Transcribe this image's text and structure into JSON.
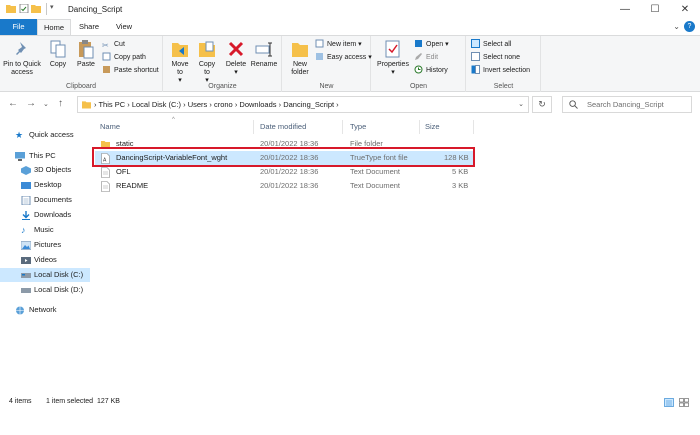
{
  "window": {
    "title": "Dancing_Script",
    "controls": {
      "minimize": "—",
      "maximize": "☐",
      "close": "✕"
    }
  },
  "ribbon_tabs": [
    "File",
    "Home",
    "Share",
    "View"
  ],
  "ribbon": {
    "clipboard": {
      "label": "Clipboard",
      "pin": "Pin to Quick access",
      "copy": "Copy",
      "paste": "Paste",
      "cut": "Cut",
      "copy_path": "Copy path",
      "paste_shortcut": "Paste shortcut"
    },
    "organize": {
      "label": "Organize",
      "move_to": "Move to",
      "copy_to": "Copy to",
      "delete": "Delete",
      "rename": "Rename"
    },
    "new": {
      "label": "New",
      "new_folder": "New folder",
      "new_item": "New item",
      "easy_access": "Easy access"
    },
    "open": {
      "label": "Open",
      "properties": "Properties",
      "open": "Open",
      "edit": "Edit",
      "history": "History"
    },
    "select": {
      "label": "Select",
      "select_all": "Select all",
      "select_none": "Select none",
      "invert": "Invert selection"
    }
  },
  "address": {
    "path": [
      "This PC",
      "Local Disk (C:)",
      "Users",
      "crono",
      "Downloads",
      "Dancing_Script"
    ],
    "search_placeholder": "Search Dancing_Script"
  },
  "nav_pane": {
    "items": [
      {
        "label": "Quick access",
        "icon": "star-icon"
      },
      {
        "label": "This PC",
        "icon": "pc-icon"
      },
      {
        "label": "3D Objects",
        "icon": "cube-icon"
      },
      {
        "label": "Desktop",
        "icon": "desktop-icon"
      },
      {
        "label": "Documents",
        "icon": "documents-icon"
      },
      {
        "label": "Downloads",
        "icon": "downloads-icon"
      },
      {
        "label": "Music",
        "icon": "music-icon"
      },
      {
        "label": "Pictures",
        "icon": "pictures-icon"
      },
      {
        "label": "Videos",
        "icon": "videos-icon"
      },
      {
        "label": "Local Disk (C:)",
        "icon": "drive-icon"
      },
      {
        "label": "Local Disk (D:)",
        "icon": "drive-icon"
      },
      {
        "label": "Network",
        "icon": "network-icon"
      }
    ]
  },
  "file_list": {
    "columns": [
      "Name",
      "Date modified",
      "Type",
      "Size"
    ],
    "rows": [
      {
        "name": "static",
        "date": "20/01/2022 18:36",
        "type": "File folder",
        "size": "",
        "icon": "folder-icon"
      },
      {
        "name": "DancingScript-VariableFont_wght",
        "date": "20/01/2022 18:36",
        "type": "TrueType font file",
        "size": "128 KB",
        "icon": "font-file-icon"
      },
      {
        "name": "OFL",
        "date": "20/01/2022 18:36",
        "type": "Text Document",
        "size": "5 KB",
        "icon": "text-file-icon"
      },
      {
        "name": "README",
        "date": "20/01/2022 18:36",
        "type": "Text Document",
        "size": "3 KB",
        "icon": "text-file-icon"
      }
    ]
  },
  "status": {
    "items": "4 items",
    "selected": "1 item selected  127 KB"
  },
  "colors": {
    "accent": "#1979ca",
    "selection": "#cce8ff",
    "highlight_border": "#d7192a",
    "folder": "#f5c04a"
  }
}
